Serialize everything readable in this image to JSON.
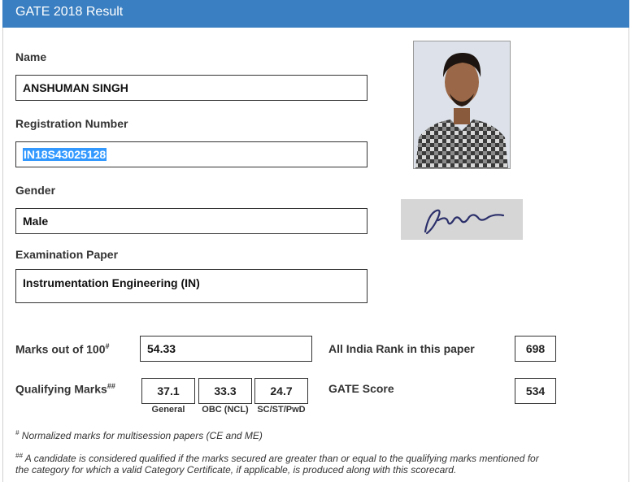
{
  "header": {
    "title": "GATE 2018 Result"
  },
  "fields": {
    "name_label": "Name",
    "name_value": "ANSHUMAN SINGH",
    "reg_label": "Registration Number",
    "reg_value": "IN18S43025128",
    "gender_label": "Gender",
    "gender_value": "Male",
    "paper_label": "Examination Paper",
    "paper_value": "Instrumentation Engineering (IN)"
  },
  "scores": {
    "marks_label": "Marks out of 100",
    "marks_sup": "#",
    "marks_value": "54.33",
    "rank_label": "All India Rank in this paper",
    "rank_value": "698",
    "qual_label": "Qualifying Marks",
    "qual_sup": "##",
    "qual_general": "37.1",
    "qual_general_cap": "General",
    "qual_obc": "33.3",
    "qual_obc_cap": "OBC (NCL)",
    "qual_sc": "24.7",
    "qual_sc_cap": "SC/ST/PwD",
    "gate_label": "GATE Score",
    "gate_value": "534"
  },
  "notes": {
    "note1_mark": "#",
    "note1": " Normalized marks for multisession papers (CE and ME)",
    "note2_mark": "##",
    "note2_line1": " A candidate is considered qualified if the marks secured are greater than or equal to the qualifying marks mentioned for",
    "note2_line2": "the category for which a valid Category Certificate, if applicable, is produced along with this scorecard."
  }
}
